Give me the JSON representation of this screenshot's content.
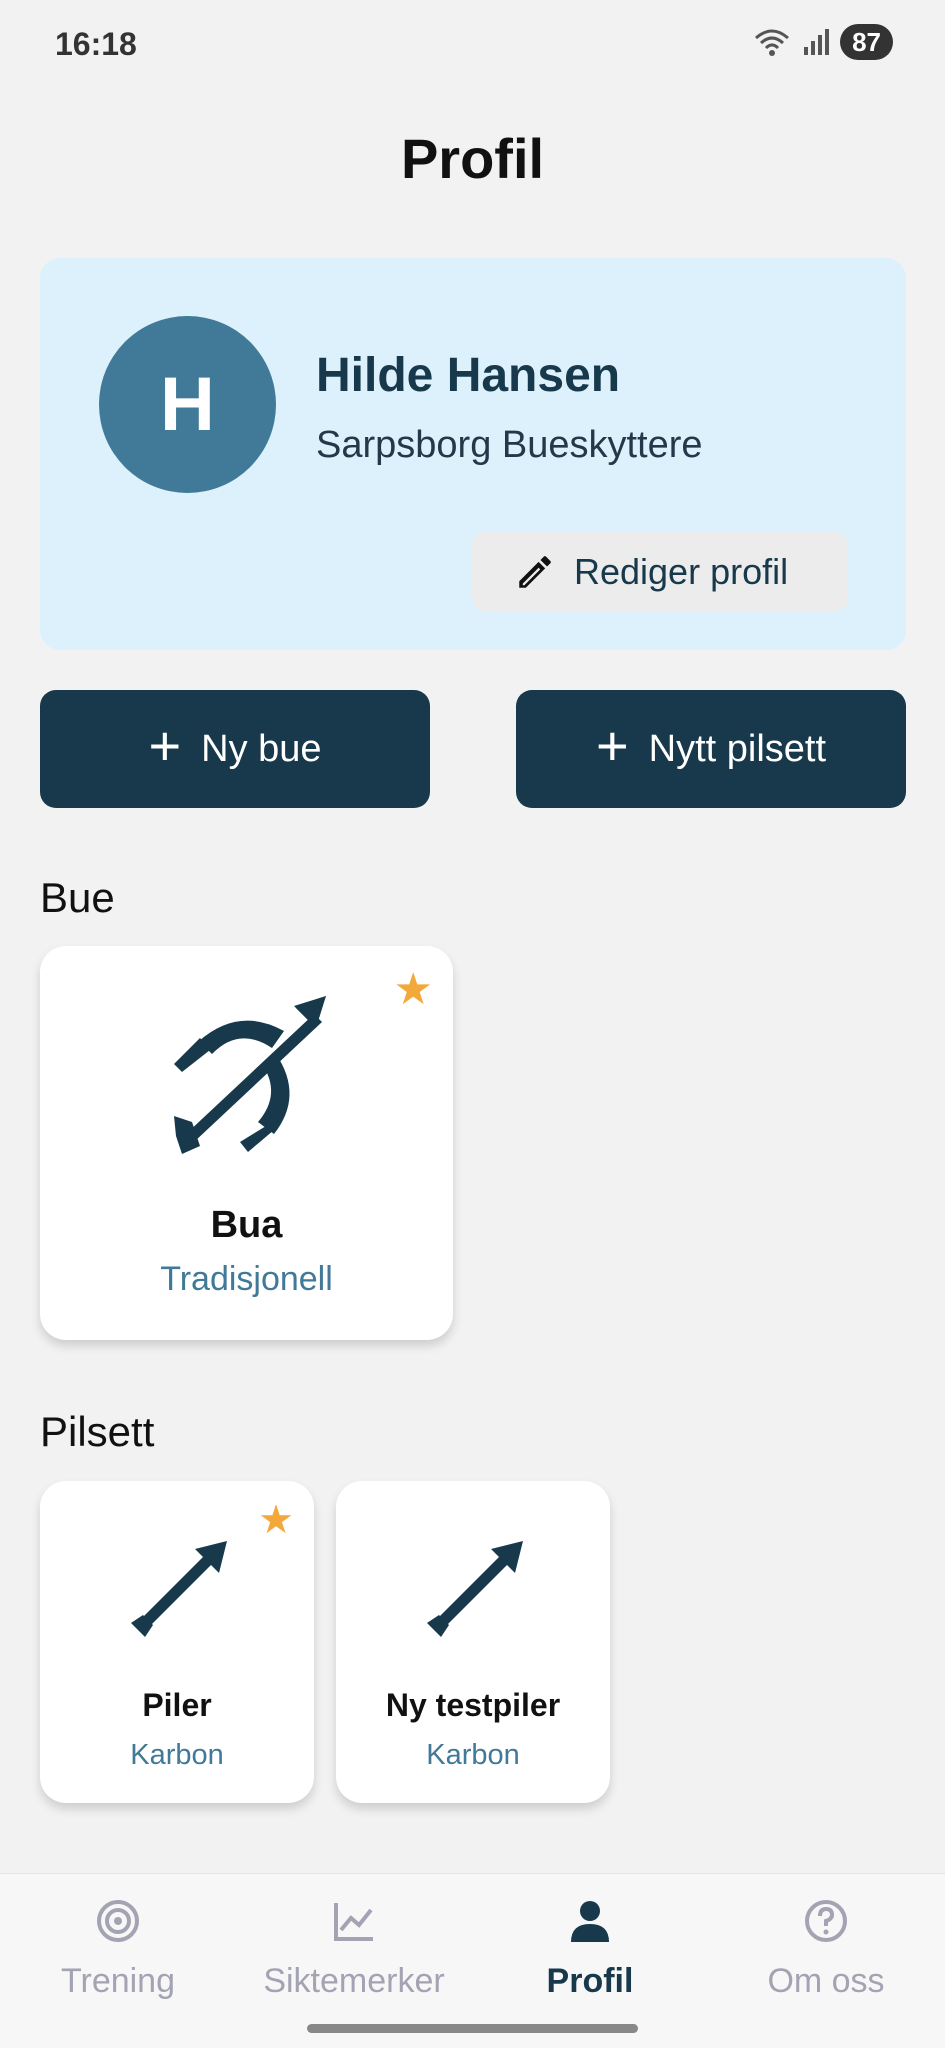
{
  "status_bar": {
    "time": "16:18",
    "battery": "87"
  },
  "header": {
    "title": "Profil"
  },
  "profile": {
    "initial": "H",
    "name": "Hilde Hansen",
    "club": "Sarpsborg Bueskyttere",
    "edit_label": "Rediger profil"
  },
  "actions": {
    "new_bow": "Ny bue",
    "new_arrowset": "Nytt pilsett"
  },
  "bows": {
    "section_title": "Bue",
    "items": [
      {
        "name": "Bua",
        "type": "Tradisjonell",
        "favorite": true
      }
    ]
  },
  "arrowsets": {
    "section_title": "Pilsett",
    "items": [
      {
        "name": "Piler",
        "material": "Karbon",
        "favorite": true
      },
      {
        "name": "Ny testpiler",
        "material": "Karbon",
        "favorite": false
      }
    ]
  },
  "nav": {
    "items": [
      {
        "label": "Trening",
        "icon": "target-icon",
        "active": false
      },
      {
        "label": "Siktemerker",
        "icon": "chart-line-icon",
        "active": false
      },
      {
        "label": "Profil",
        "icon": "user-icon",
        "active": true
      },
      {
        "label": "Om oss",
        "icon": "question-icon",
        "active": false
      }
    ]
  },
  "colors": {
    "accent": "#17394b",
    "avatar": "#417a98",
    "card_bg": "#dcf1fb",
    "star": "#f2a83a"
  }
}
